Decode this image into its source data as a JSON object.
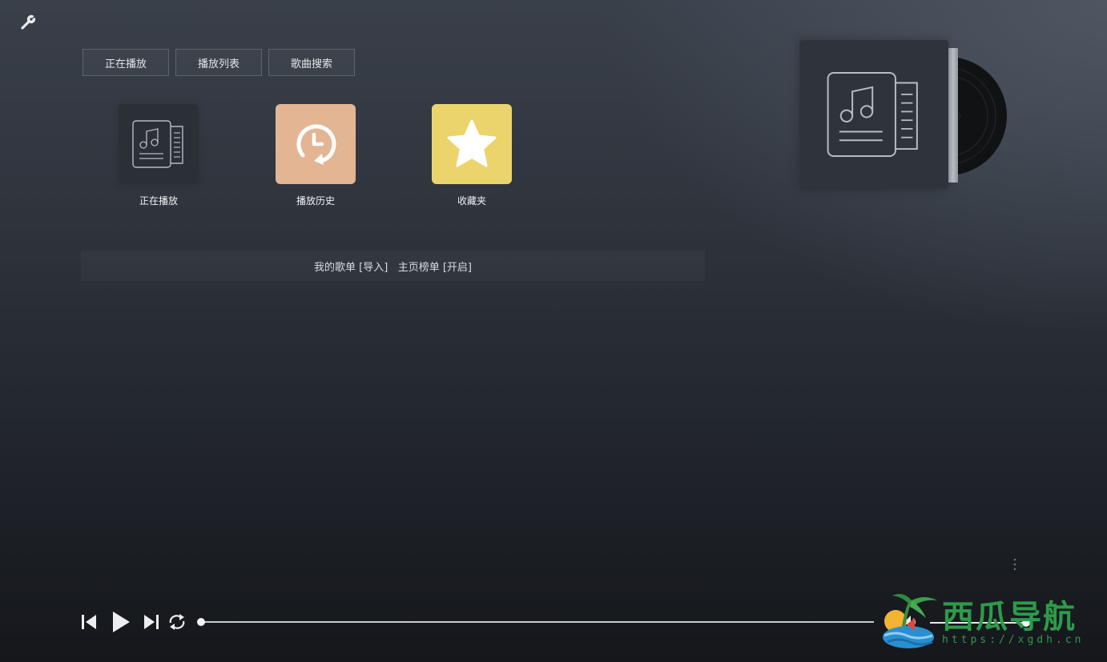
{
  "tabs": [
    {
      "label": "正在播放"
    },
    {
      "label": "播放列表"
    },
    {
      "label": "歌曲搜索"
    }
  ],
  "tiles": [
    {
      "label": "正在播放",
      "icon": "music-sheet-icon",
      "color": "#2b2f36"
    },
    {
      "label": "播放历史",
      "icon": "history-clock-icon",
      "color": "#e3b593"
    },
    {
      "label": "收藏夹",
      "icon": "star-icon",
      "color": "#ecd46c"
    }
  ],
  "playlist_bar": {
    "my_list": "我的歌单",
    "import": "[导入]",
    "home_chart": "主页榜单",
    "enable": "[开启]"
  },
  "player": {
    "progress": 0.0,
    "volume": 1.0
  },
  "watermark": {
    "name": "西瓜导航",
    "url": "https://xgdh.cn"
  },
  "icons": {
    "settings": "wrench-icon",
    "prev": "previous-icon",
    "play": "play-icon",
    "next": "next-icon",
    "repeat": "repeat-icon",
    "volume": "volume-icon",
    "more": "vertical-dots-icon"
  }
}
